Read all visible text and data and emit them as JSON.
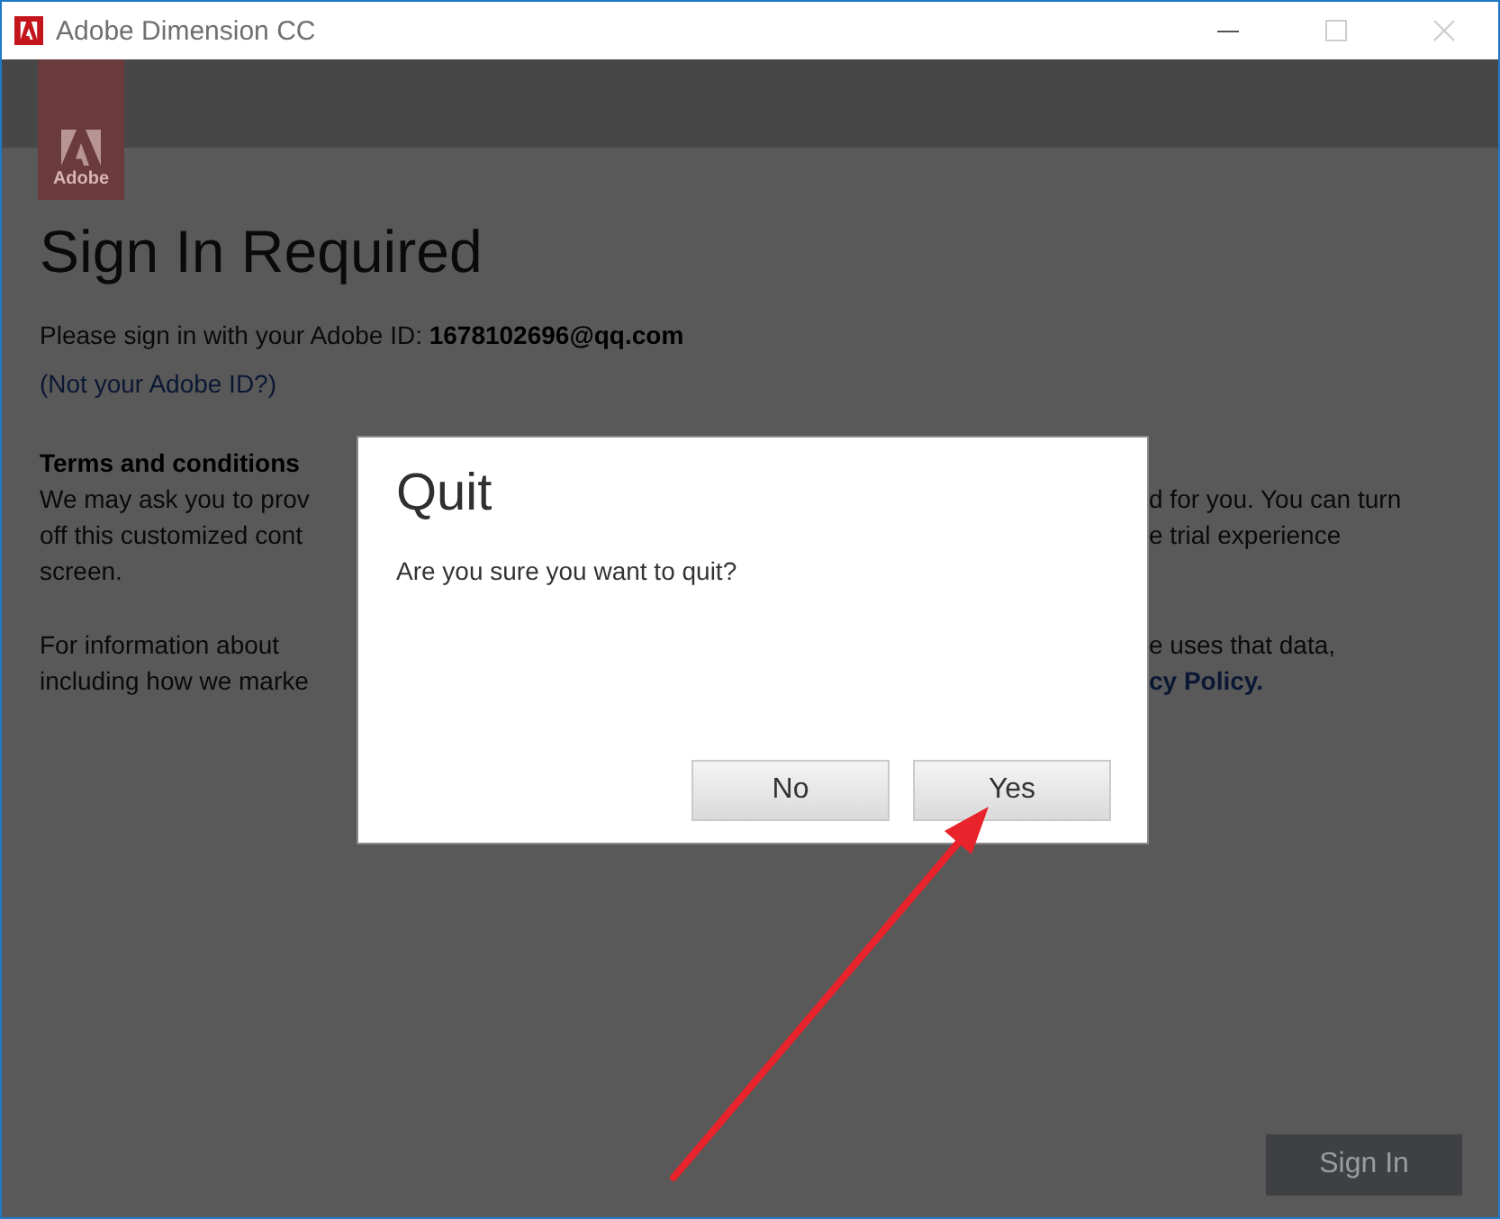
{
  "window": {
    "title": "Adobe Dimension CC",
    "controls": [
      {
        "kind": "minimize",
        "disabled": false
      },
      {
        "kind": "maximize",
        "disabled": true
      },
      {
        "kind": "close",
        "disabled": true
      }
    ]
  },
  "logo": {
    "label": "Adobe"
  },
  "sign_in": {
    "heading": "Sign In Required",
    "prompt": "Please sign in with your Adobe ID: **1678102696@qq.com**",
    "switch_link": "(Not your Adobe ID?)",
    "terms_rows": [
      {
        "left": {
          "text": "Terms and conditions",
          "kind": "heading"
        }
      },
      {
        "left": {
          "text": "We may ask you to prov",
          "kind": "text"
        },
        "right": {
          "text": "d for you. You can turn",
          "kind": "text"
        }
      },
      {
        "left": {
          "text": "off this customized cont",
          "kind": "text"
        },
        "right": {
          "text": "e trial experience",
          "kind": "text"
        }
      },
      {
        "left": {
          "text": "screen.",
          "kind": "text"
        }
      }
    ],
    "info_rows": [
      {
        "left": {
          "text": "For information about",
          "kind": "text"
        },
        "right": {
          "text": "e uses that data,",
          "kind": "text"
        }
      },
      {
        "left": {
          "text": "including how we marke",
          "kind": "text"
        },
        "right": {
          "text": "cy Policy.",
          "kind": "link"
        }
      }
    ],
    "button": "Sign In"
  },
  "dialog": {
    "title": "Quit",
    "message": "Are you sure you want to quit?",
    "buttons": [
      "No",
      "Yes"
    ]
  }
}
